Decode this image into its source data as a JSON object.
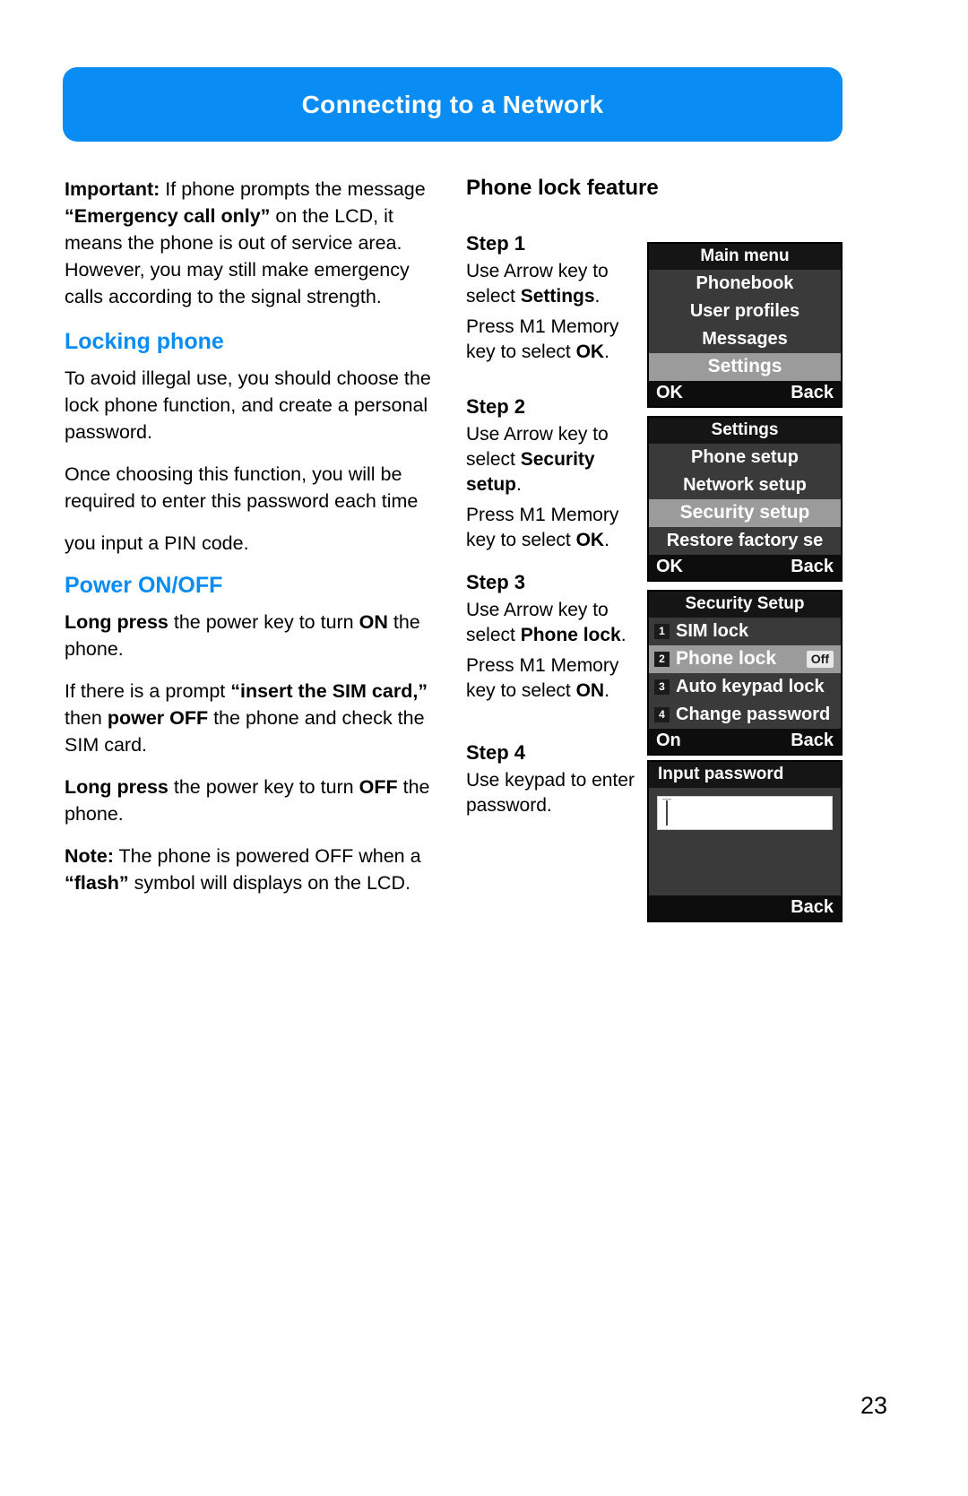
{
  "header": {
    "title": "Connecting to a Network"
  },
  "theme": {
    "accent": "#0a8cf5",
    "lcd_bg": "#3a3a3a",
    "lcd_title_bg": "#151515",
    "lcd_selected_bg": "#9b9b9b",
    "lcd_softkey_bg": "#0d0d0d"
  },
  "left_column": {
    "important_paragraph": {
      "lead": "Important:",
      "part1": " If phone prompts the message ",
      "quote": "“Emergency call only”",
      "part2": " on the LCD, it means the phone is out of service area. However, you may still make emergency calls according to the signal strength."
    },
    "locking_phone": {
      "heading": "Locking phone",
      "paragraph1": "To avoid illegal use, you should choose the lock phone function, and create a personal password.",
      "paragraph2": "Once choosing this function, you will be required to enter this password each time",
      "paragraph3": "you input a PIN code."
    },
    "power_onoff": {
      "heading": "Power ON/OFF",
      "p1_bold": "Long press",
      "p1_mid": " the power key to turn ",
      "p1_bold2": "ON",
      "p1_end": " the phone.",
      "p2_start": "If there is a prompt ",
      "p2_bold": "“insert the SIM card,”",
      "p2_mid": " then ",
      "p2_bold2": "power OFF",
      "p2_end": " the phone and check the SIM card.",
      "p3_bold": "Long press",
      "p3_mid": " the power key to turn ",
      "p3_bold2": "OFF",
      "p3_end": " the phone.",
      "note_lead": "Note:",
      "note_part1": " The phone is powered OFF when a ",
      "note_bold": "“flash”",
      "note_part2": " symbol will displays on the LCD."
    }
  },
  "right_column": {
    "heading": "Phone lock feature",
    "steps": [
      {
        "label": "Step 1",
        "line1_a": "Use Arrow key to select ",
        "line1_bold": "Settings",
        "line1_b": ".",
        "line2_a": "Press M1 Memory key to select ",
        "line2_bold": "OK",
        "line2_b": "."
      },
      {
        "label": "Step 2",
        "line1_a": "Use Arrow key to select ",
        "line1_bold": "Security setup",
        "line1_b": ".",
        "line2_a": "Press M1 Memory key to select ",
        "line2_bold": "OK",
        "line2_b": "."
      },
      {
        "label": "Step 3",
        "line1_a": "Use Arrow key to select ",
        "line1_bold": "Phone lock",
        "line1_b": ".",
        "line2_a": "Press M1 Memory key to select ",
        "line2_bold": "ON",
        "line2_b": "."
      },
      {
        "label": "Step 4",
        "line1_a": "Use keypad to enter password.",
        "line1_bold": "",
        "line1_b": "",
        "line2_a": "",
        "line2_bold": "",
        "line2_b": ""
      }
    ],
    "screens": [
      {
        "title": "Main menu",
        "items": [
          {
            "label": "Phonebook",
            "selected": false
          },
          {
            "label": "User profiles",
            "selected": false
          },
          {
            "label": "Messages",
            "selected": false
          },
          {
            "label": "Settings",
            "selected": true
          }
        ],
        "softkey_left": "OK",
        "softkey_right": "Back"
      },
      {
        "title": "Settings",
        "items": [
          {
            "label": "Phone setup",
            "selected": false
          },
          {
            "label": "Network setup",
            "selected": false
          },
          {
            "label": "Security setup",
            "selected": true
          },
          {
            "label": "Restore factory se",
            "selected": false
          }
        ],
        "softkey_left": "OK",
        "softkey_right": "Back"
      },
      {
        "title": "Security Setup",
        "items": [
          {
            "num": "1",
            "label": "SIM lock",
            "selected": false,
            "badge": ""
          },
          {
            "num": "2",
            "label": "Phone lock",
            "selected": true,
            "badge": "Off"
          },
          {
            "num": "3",
            "label": "Auto keypad lock",
            "selected": false,
            "badge": ""
          },
          {
            "num": "4",
            "label": "Change password",
            "selected": false,
            "badge": ""
          }
        ],
        "softkey_left": "On",
        "softkey_right": "Back"
      },
      {
        "title": "Input password",
        "input_value": "",
        "softkey_left": "",
        "softkey_right": "Back"
      }
    ]
  },
  "footer": {
    "page_number": "23"
  }
}
